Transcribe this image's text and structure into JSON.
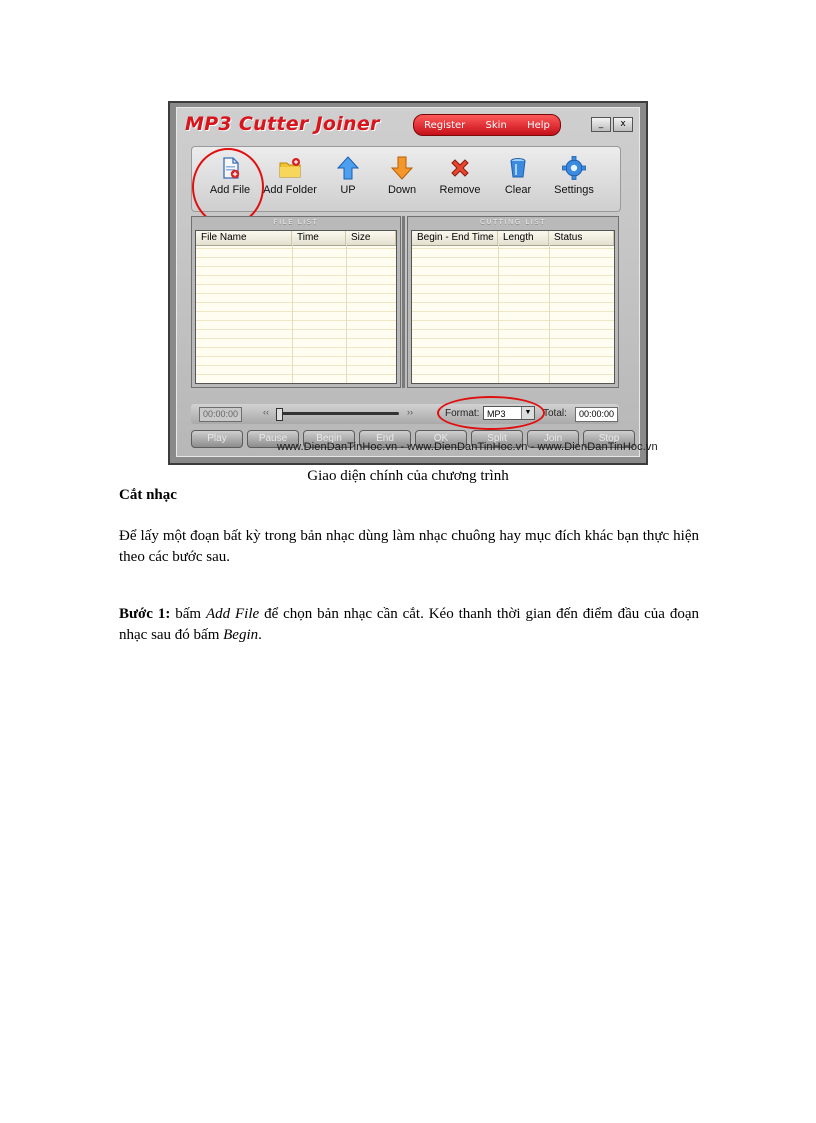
{
  "screenshot": {
    "app_title": "MP3 Cutter Joiner",
    "menu": [
      "Register",
      "Skin",
      "Help"
    ],
    "window_buttons": [
      "_",
      "x"
    ],
    "toolbar": [
      {
        "label": "Add File",
        "icon": "add-file-icon",
        "color": "#1f6fd6"
      },
      {
        "label": "Add Folder",
        "icon": "folder-icon",
        "color": "#e6b21a"
      },
      {
        "label": "UP",
        "icon": "arrow-up-icon",
        "color": "#3a8ee6"
      },
      {
        "label": "Down",
        "icon": "arrow-down-icon",
        "color": "#f08a1c"
      },
      {
        "label": "Remove",
        "icon": "remove-icon",
        "color": "#e03a22"
      },
      {
        "label": "Clear",
        "icon": "clear-icon",
        "color": "#2a7bd4"
      },
      {
        "label": "Settings",
        "icon": "gear-icon",
        "color": "#2a7bd4"
      }
    ],
    "file_list": {
      "caption": "FILE LIST",
      "columns": [
        "File Name",
        "Time",
        "Size"
      ]
    },
    "cutting_list": {
      "caption": "CUTTING LIST",
      "columns": [
        "Begin - End Time",
        "Length",
        "Status"
      ]
    },
    "status": {
      "current_time": "00:00:00",
      "rewind": "‹‹",
      "forward": "››",
      "format_label": "Format:",
      "format_value": "MP3",
      "total_label": "Total:",
      "total_time": "00:00:00"
    },
    "buttons": [
      "Play",
      "Pause",
      "Begin",
      "End",
      "OK",
      "Split",
      "Join",
      "Stop"
    ],
    "watermark": "www.DienDanTinHoc.vn - www.DienDanTinHoc.vn - www.DienDanTinHoc.vn",
    "highlight_color": "#e01010"
  },
  "document": {
    "caption": "Giao diện chính  của chương trình",
    "heading": "Cắt nhạc",
    "paragraph1": "Để lấy một đoạn bất kỳ trong bản nhạc dùng làm nhạc chuông hay mục đích khác bạn thực hiện  theo các bước sau.",
    "step1_label": "Bước 1:",
    "step1_text_a": " bấm ",
    "step1_em1": "Add File",
    "step1_text_b": " để chọn bản nhạc cần cắt. Kéo thanh thời gian đến điểm đầu của đoạn nhạc sau đó bấm ",
    "step1_em2": "Begin",
    "step1_text_c": "."
  }
}
